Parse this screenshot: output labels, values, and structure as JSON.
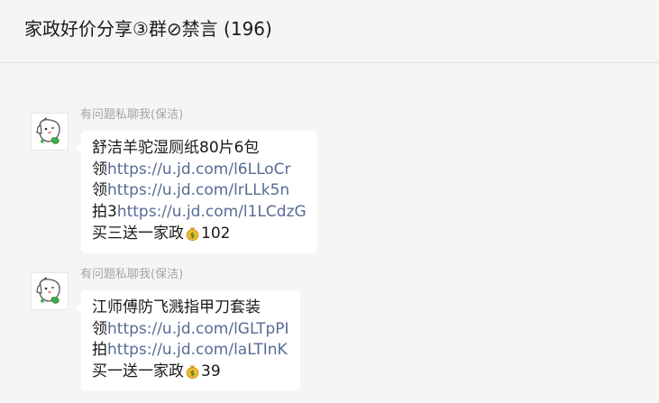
{
  "header": {
    "title": "家政好价分享③群⊘禁言 (196)"
  },
  "messages": [
    {
      "sender": "有问题私聊我(保洁)",
      "avatar_icon": "cartoon-dog-avatar",
      "lines": [
        {
          "prefix": "舒洁羊驼湿厕纸80片6包",
          "link": "",
          "suffix": ""
        },
        {
          "prefix": "领",
          "link": "https://u.jd.com/l6LLoCr",
          "suffix": ""
        },
        {
          "prefix": "领",
          "link": "https://u.jd.com/lrLLk5n",
          "suffix": ""
        },
        {
          "prefix": "拍3",
          "link": "https://u.jd.com/l1LCdzG",
          "suffix": ""
        },
        {
          "prefix": "买三送一家政",
          "link": "",
          "icon": "money-bag-icon",
          "suffix": "102"
        }
      ]
    },
    {
      "sender": "有问题私聊我(保洁)",
      "avatar_icon": "cartoon-dog-avatar",
      "lines": [
        {
          "prefix": "江师傅防飞溅指甲刀套装",
          "link": "",
          "suffix": ""
        },
        {
          "prefix": "领",
          "link": "https://u.jd.com/lGLTpPI",
          "suffix": ""
        },
        {
          "prefix": "拍",
          "link": "https://u.jd.com/laLTInK",
          "suffix": ""
        },
        {
          "prefix": "买一送一家政",
          "link": "",
          "icon": "money-bag-icon",
          "suffix": "39"
        }
      ]
    }
  ],
  "colors": {
    "background": "#f5f5f5",
    "bubble": "#ffffff",
    "link": "#576b95",
    "sender": "#a4a4a4"
  }
}
